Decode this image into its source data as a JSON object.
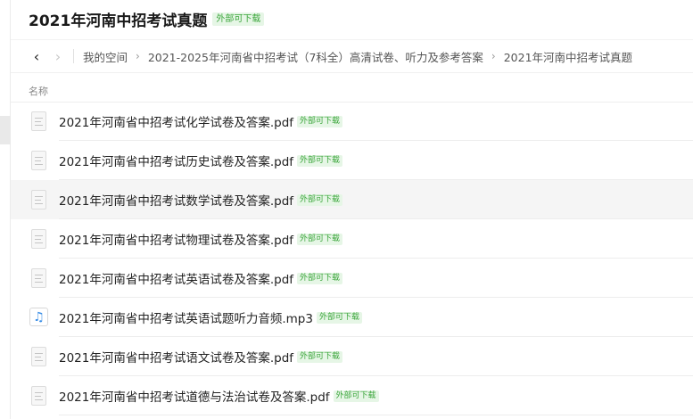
{
  "title": "2021年河南中招考试真题",
  "badge": "外部可下载",
  "breadcrumb": [
    "我的空间",
    "2021-2025年河南省中招考试（7科全）高清试卷、听力及参考答案",
    "2021年河南中招考试真题"
  ],
  "nav": {
    "back_icon": "‹",
    "forward_icon": "›",
    "separator_icon": "›"
  },
  "column_header": "名称",
  "files": [
    {
      "name": "2021年河南省中招考试化学试卷及答案.pdf",
      "badge": "外部可下载",
      "type": "pdf-icon"
    },
    {
      "name": "2021年河南省中招考试历史试卷及答案.pdf",
      "badge": "外部可下载",
      "type": "pdf-icon"
    },
    {
      "name": "2021年河南省中招考试数学试卷及答案.pdf",
      "badge": "外部可下载",
      "type": "pdf-icon"
    },
    {
      "name": "2021年河南省中招考试物理试卷及答案.pdf",
      "badge": "外部可下载",
      "type": "pdf-icon"
    },
    {
      "name": "2021年河南省中招考试英语试卷及答案.pdf",
      "badge": "外部可下载",
      "type": "pdf-icon"
    },
    {
      "name": "2021年河南省中招考试英语试题听力音频.mp3",
      "badge": "外部可下载",
      "type": "music-note-icon",
      "glyph": "♫"
    },
    {
      "name": "2021年河南省中招考试语文试卷及答案.pdf",
      "badge": "外部可下载",
      "type": "pdf-icon"
    },
    {
      "name": "2021年河南省中招考试道德与法治试卷及答案.pdf",
      "badge": "外部可下载",
      "type": "pdf-icon"
    }
  ],
  "colors": {
    "badge_bg": "#e6f6e6",
    "badge_text": "#3aa53a",
    "audio_icon": "#3a8ee6",
    "hover_row": "#f5f5f5"
  }
}
